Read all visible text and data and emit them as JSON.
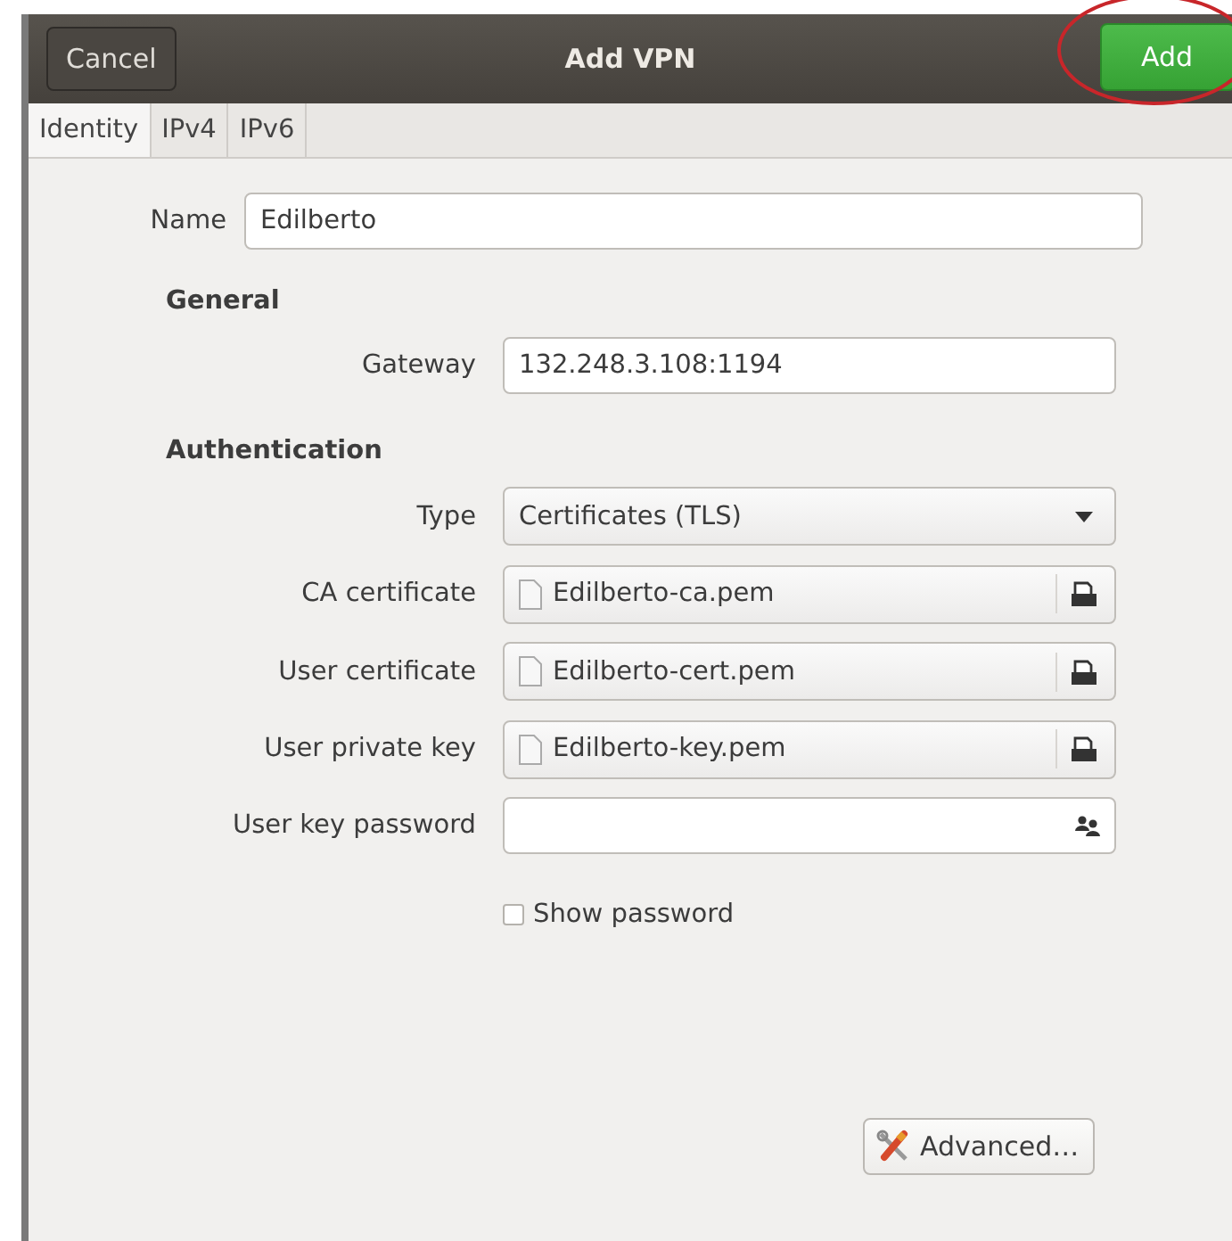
{
  "header": {
    "title": "Add VPN",
    "cancel": "Cancel",
    "add": "Add"
  },
  "tabs": [
    {
      "label": "Identity",
      "selected": true
    },
    {
      "label": "IPv4",
      "selected": false
    },
    {
      "label": "IPv6",
      "selected": false
    }
  ],
  "name": {
    "label": "Name",
    "value": "Edilberto"
  },
  "sections": [
    {
      "heading": "General",
      "rows": [
        {
          "kind": "text",
          "label": "Gateway",
          "value": "132.248.3.108:1194"
        }
      ]
    },
    {
      "heading": "Authentication",
      "rows": [
        {
          "kind": "dropdown",
          "label": "Type",
          "value": "Certificates (TLS)"
        },
        {
          "kind": "file",
          "label": "CA certificate",
          "value": "Edilberto-ca.pem"
        },
        {
          "kind": "file",
          "label": "User certificate",
          "value": "Edilberto-cert.pem"
        },
        {
          "kind": "file",
          "label": "User private key",
          "value": "Edilberto-key.pem"
        },
        {
          "kind": "password",
          "label": "User key password",
          "value": ""
        }
      ]
    }
  ],
  "show_password": {
    "label": "Show password",
    "checked": false
  },
  "advanced": "Advanced…"
}
